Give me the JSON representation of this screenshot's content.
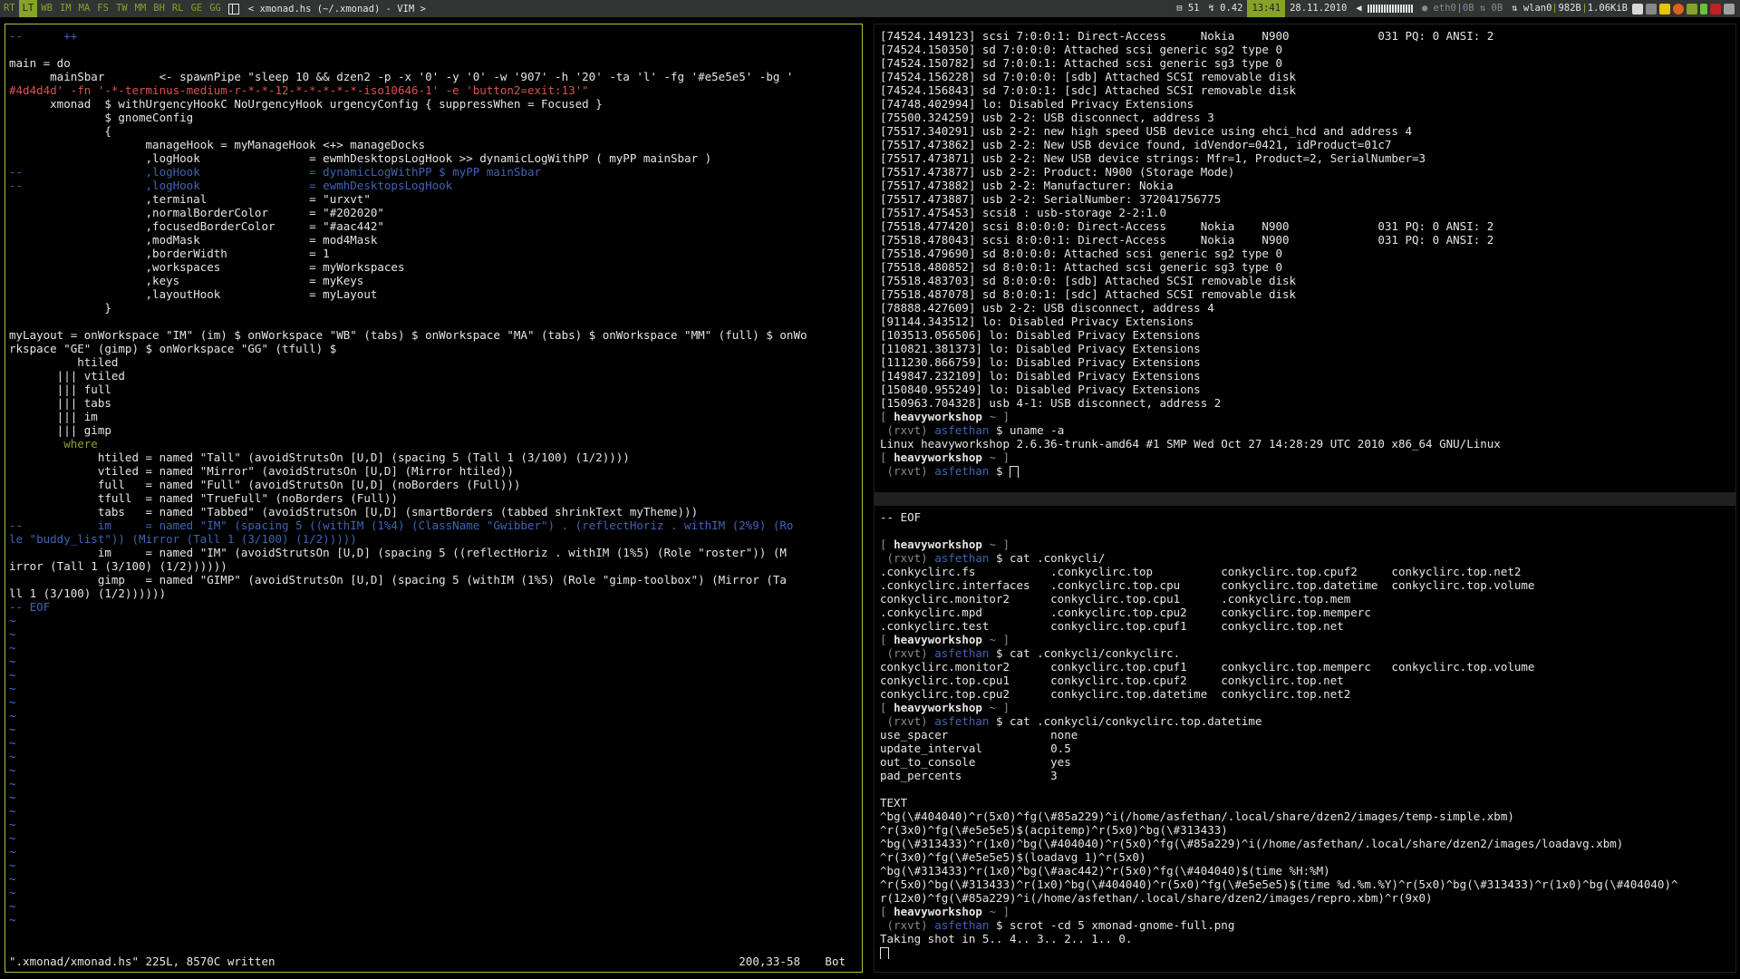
{
  "bar": {
    "workspaces": [
      {
        "label": "RT",
        "state": "normal"
      },
      {
        "label": "LT",
        "state": "current"
      },
      {
        "label": "WB",
        "state": "normal"
      },
      {
        "label": "IM",
        "state": "normal"
      },
      {
        "label": "MA",
        "state": "normal"
      },
      {
        "label": "FS",
        "state": "normal"
      },
      {
        "label": "TW",
        "state": "normal"
      },
      {
        "label": "MM",
        "state": "normal"
      },
      {
        "label": "BH",
        "state": "normal"
      },
      {
        "label": "RL",
        "state": "normal"
      },
      {
        "label": "GE",
        "state": "normal"
      },
      {
        "label": "GG",
        "state": "normal"
      }
    ],
    "window_title": "< xmonad.hs (~/.xmonad) - VIM >",
    "stats": {
      "workspace_count": "51",
      "load": "0.42",
      "time": "13:41",
      "date": "28.11.2010",
      "eth_iface": "eth0",
      "eth_down": "0B",
      "eth_up": "0B",
      "wlan_iface": "wlan0",
      "wlan_down": "982B",
      "wlan_up": "1.06KiB"
    },
    "colors": {
      "accent": "#85a229",
      "bg": "#313433",
      "fg": "#e5e5e5",
      "border": "#aac442"
    }
  },
  "vim": {
    "lines": [
      {
        "t": "--      ++",
        "c": "comment"
      },
      {
        "t": "",
        "c": ""
      },
      {
        "t": "main = do",
        "c": ""
      },
      {
        "t": "      mainSbar        <- spawnPipe \"sleep 10 && dzen2 -p -x '0' -y '0' -w '907' -h '20' -ta 'l' -fg '#e5e5e5' -bg '",
        "c": ""
      },
      {
        "t": "#4d4d4d' -fn '-*-terminus-medium-r-*-*-12-*-*-*-*-*-iso10646-1' -e 'button2=exit:13'\"",
        "c": "str"
      },
      {
        "t": "      xmonad  $ withUrgencyHookC NoUrgencyHook urgencyConfig { suppressWhen = Focused }",
        "c": ""
      },
      {
        "t": "              $ gnomeConfig",
        "c": ""
      },
      {
        "t": "              {",
        "c": ""
      },
      {
        "t": "                    manageHook = myManageHook <+> manageDocks",
        "c": ""
      },
      {
        "t": "                    ,logHook                = ewmhDesktopsLogHook >> dynamicLogWithPP ( myPP mainSbar )",
        "c": ""
      },
      {
        "t": "--                  ,logHook                = dynamicLogWithPP $ myPP mainSbar",
        "c": "comment"
      },
      {
        "t": "--                  ,logHook                = ewmhDesktopsLogHook",
        "c": "comment"
      },
      {
        "t": "                    ,terminal               = \"urxvt\"",
        "c": ""
      },
      {
        "t": "                    ,normalBorderColor      = \"#202020\"",
        "c": ""
      },
      {
        "t": "                    ,focusedBorderColor     = \"#aac442\"",
        "c": ""
      },
      {
        "t": "                    ,modMask                = mod4Mask",
        "c": ""
      },
      {
        "t": "                    ,borderWidth            = 1",
        "c": ""
      },
      {
        "t": "                    ,workspaces             = myWorkspaces",
        "c": ""
      },
      {
        "t": "                    ,keys                   = myKeys",
        "c": ""
      },
      {
        "t": "                    ,layoutHook             = myLayout",
        "c": ""
      },
      {
        "t": "              }",
        "c": ""
      },
      {
        "t": "",
        "c": ""
      },
      {
        "t": "myLayout = onWorkspace \"IM\" (im) $ onWorkspace \"WB\" (tabs) $ onWorkspace \"MA\" (tabs) $ onWorkspace \"MM\" (full) $ onWo",
        "c": ""
      },
      {
        "t": "rkspace \"GE\" (gimp) $ onWorkspace \"GG\" (tfull) $",
        "c": ""
      },
      {
        "t": "          htiled",
        "c": ""
      },
      {
        "t": "       ||| vtiled",
        "c": ""
      },
      {
        "t": "       ||| full",
        "c": ""
      },
      {
        "t": "       ||| tabs",
        "c": ""
      },
      {
        "t": "       ||| im",
        "c": ""
      },
      {
        "t": "       ||| gimp",
        "c": ""
      },
      {
        "t": "        where",
        "c": "kw"
      },
      {
        "t": "             htiled = named \"Tall\" (avoidStrutsOn [U,D] (spacing 5 (Tall 1 (3/100) (1/2))))",
        "c": ""
      },
      {
        "t": "             vtiled = named \"Mirror\" (avoidStrutsOn [U,D] (Mirror htiled))",
        "c": ""
      },
      {
        "t": "             full   = named \"Full\" (avoidStrutsOn [U,D] (noBorders (Full)))",
        "c": ""
      },
      {
        "t": "             tfull  = named \"TrueFull\" (noBorders (Full))",
        "c": ""
      },
      {
        "t": "             tabs   = named \"Tabbed\" (avoidStrutsOn [U,D] (smartBorders (tabbed shrinkText myTheme)))",
        "c": ""
      },
      {
        "t": "--           im     = named \"IM\" (spacing 5 ((withIM (1%4) (ClassName \"Gwibber\") . (reflectHoriz . withIM (2%9) (Ro",
        "c": "comment"
      },
      {
        "t": "le \"buddy_list\")) (Mirror (Tall 1 (3/100) (1/2)))))",
        "c": "comment"
      },
      {
        "t": "             im     = named \"IM\" (avoidStrutsOn [U,D] (spacing 5 ((reflectHoriz . withIM (1%5) (Role \"roster\")) (M",
        "c": ""
      },
      {
        "t": "irror (Tall 1 (3/100) (1/2))))))",
        "c": ""
      },
      {
        "t": "             gimp   = named \"GIMP\" (avoidStrutsOn [U,D] (spacing 5 (withIM (1%5) (Role \"gimp-toolbox\") (Mirror (Ta",
        "c": ""
      },
      {
        "t": "ll 1 (3/100) (1/2))))))",
        "c": ""
      },
      {
        "t": "-- EOF",
        "c": "comment"
      }
    ],
    "tilde": "~",
    "tilde_rows": 23,
    "status": {
      "message": "\".xmonad/xmonad.hs\" 225L, 8570C written",
      "position": "200,33-58",
      "scroll": "Bot"
    }
  },
  "term_top": {
    "lines": [
      {
        "t": "[74524.149123] scsi 7:0:0:1: Direct-Access     Nokia    N900             031 PQ: 0 ANSI: 2"
      },
      {
        "t": "[74524.150350] sd 7:0:0:0: Attached scsi generic sg2 type 0"
      },
      {
        "t": "[74524.150782] sd 7:0:0:1: Attached scsi generic sg3 type 0"
      },
      {
        "t": "[74524.156228] sd 7:0:0:0: [sdb] Attached SCSI removable disk"
      },
      {
        "t": "[74524.156843] sd 7:0:0:1: [sdc] Attached SCSI removable disk"
      },
      {
        "t": "[74748.402994] lo: Disabled Privacy Extensions"
      },
      {
        "t": "[75500.324259] usb 2-2: USB disconnect, address 3"
      },
      {
        "t": "[75517.340291] usb 2-2: new high speed USB device using ehci_hcd and address 4"
      },
      {
        "t": "[75517.473862] usb 2-2: New USB device found, idVendor=0421, idProduct=01c7"
      },
      {
        "t": "[75517.473871] usb 2-2: New USB device strings: Mfr=1, Product=2, SerialNumber=3"
      },
      {
        "t": "[75517.473877] usb 2-2: Product: N900 (Storage Mode)"
      },
      {
        "t": "[75517.473882] usb 2-2: Manufacturer: Nokia"
      },
      {
        "t": "[75517.473887] usb 2-2: SerialNumber: 372041756775"
      },
      {
        "t": "[75517.475453] scsi8 : usb-storage 2-2:1.0"
      },
      {
        "t": "[75518.477420] scsi 8:0:0:0: Direct-Access     Nokia    N900             031 PQ: 0 ANSI: 2"
      },
      {
        "t": "[75518.478043] scsi 8:0:0:1: Direct-Access     Nokia    N900             031 PQ: 0 ANSI: 2"
      },
      {
        "t": "[75518.479690] sd 8:0:0:0: Attached scsi generic sg2 type 0"
      },
      {
        "t": "[75518.480852] sd 8:0:0:1: Attached scsi generic sg3 type 0"
      },
      {
        "t": "[75518.483703] sd 8:0:0:0: [sdb] Attached SCSI removable disk"
      },
      {
        "t": "[75518.487078] sd 8:0:0:1: [sdc] Attached SCSI removable disk"
      },
      {
        "t": "[78888.427609] usb 2-2: USB disconnect, address 4"
      },
      {
        "t": "[91144.343512] lo: Disabled Privacy Extensions"
      },
      {
        "t": "[103513.056506] lo: Disabled Privacy Extensions"
      },
      {
        "t": "[110821.381373] lo: Disabled Privacy Extensions"
      },
      {
        "t": "[111230.866759] lo: Disabled Privacy Extensions"
      },
      {
        "t": "[149847.232109] lo: Disabled Privacy Extensions"
      },
      {
        "t": "[150840.955249] lo: Disabled Privacy Extensions"
      },
      {
        "t": "[150963.704328] usb 4-1: USB disconnect, address 2"
      }
    ],
    "prompt1": {
      "host": "heavyworkshop",
      "path": "~",
      "user": "asfethan",
      "command": "uname -a"
    },
    "output": "Linux heavyworkshop 2.6.36-trunk-amd64 #1 SMP Wed Oct 27 14:28:29 UTC 2010 x86_64 GNU/Linux",
    "prompt2": {
      "host": "heavyworkshop",
      "path": "~",
      "user": "asfethan",
      "command": ""
    }
  },
  "term_bottom": {
    "eof": "-- EOF",
    "p1": {
      "host": "heavyworkshop",
      "path": "~",
      "user": "asfethan",
      "command": "cat .conkycli/"
    },
    "ls1": [
      ".conkyclirc.fs           .conkyclirc.top          conkyclirc.top.cpuf2     conkyclirc.top.net2",
      ".conkyclirc.interfaces   .conkyclirc.top.cpu      conkyclirc.top.datetime  conkyclirc.top.volume",
      "conkyclirc.monitor2      conkyclirc.top.cpu1      .conkyclirc.top.mem",
      ".conkyclirc.mpd          .conkyclirc.top.cpu2     conkyclirc.top.memperc",
      ".conkyclirc.test         conkyclirc.top.cpuf1     conkyclirc.top.net"
    ],
    "p2": {
      "host": "heavyworkshop",
      "path": "~",
      "user": "asfethan",
      "command": "cat .conkycli/conkyclirc."
    },
    "ls2": [
      "conkyclirc.monitor2      conkyclirc.top.cpuf1     conkyclirc.top.memperc   conkyclirc.top.volume",
      "conkyclirc.top.cpu1      conkyclirc.top.cpuf2     conkyclirc.top.net",
      "conkyclirc.top.cpu2      conkyclirc.top.datetime  conkyclirc.top.net2"
    ],
    "p3": {
      "host": "heavyworkshop",
      "path": "~",
      "user": "asfethan",
      "command": "cat .conkycli/conkyclirc.top.datetime"
    },
    "cfg": [
      "use_spacer               none",
      "update_interval          0.5",
      "out_to_console           yes",
      "pad_percents             3",
      "",
      "TEXT",
      "^bg(\\#404040)^r(5x0)^fg(\\#85a229)^i(/home/asfethan/.local/share/dzen2/images/temp-simple.xbm)",
      "^r(3x0)^fg(\\#e5e5e5)$(acpitemp)^r(5x0)^bg(\\#313433)",
      "^bg(\\#313433)^r(1x0)^bg(\\#404040)^r(5x0)^fg(\\#85a229)^i(/home/asfethan/.local/share/dzen2/images/loadavg.xbm)",
      "^r(3x0)^fg(\\#e5e5e5)$(loadavg 1)^r(5x0)",
      "^bg(\\#313433)^r(1x0)^bg(\\#aac442)^r(5x0)^fg(\\#404040)$(time %H:%M)",
      "^r(5x0)^bg(\\#313433)^r(1x0)^bg(\\#404040)^r(5x0)^fg(\\#e5e5e5)$(time %d.%m.%Y)^r(5x0)^bg(\\#313433)^r(1x0)^bg(\\#404040)^",
      "r(12x0)^fg(\\#85a229)^i(/home/asfethan/.local/share/dzen2/images/repro.xbm)^r(9x0)"
    ],
    "p4": {
      "host": "heavyworkshop",
      "path": "~",
      "user": "asfethan",
      "command": "scrot -cd 5 xmonad-gnome-full.png"
    },
    "output": "Taking shot in 5.. 4.. 3.. 2.. 1.. 0."
  }
}
